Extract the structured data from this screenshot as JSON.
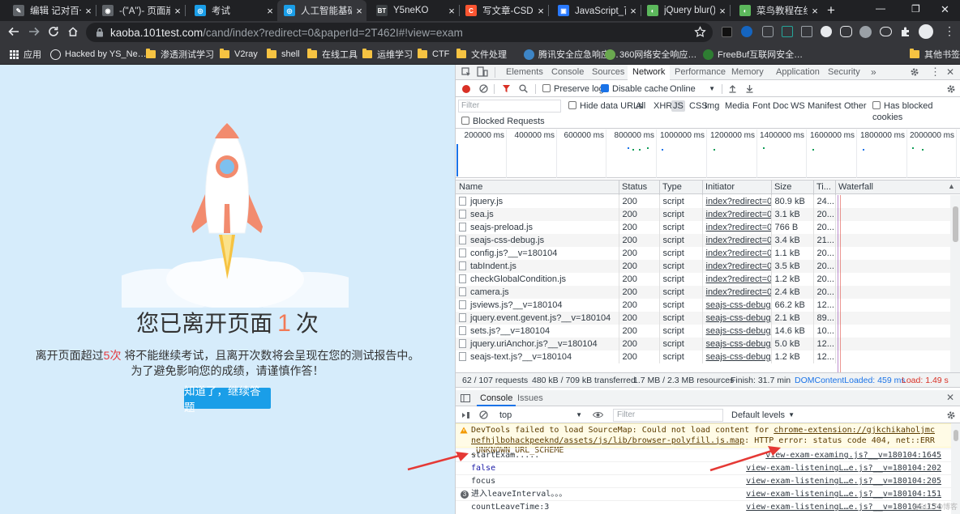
{
  "browser": {
    "tabs": [
      {
        "title": "编辑 记对百一…",
        "fav_color": "#5f6368",
        "fav_text": "✎"
      },
      {
        "title": "-(\"A\")- 页面崩…",
        "fav_color": "#5f6368",
        "fav_text": "◉"
      },
      {
        "title": "考试",
        "fav_color": "#1a9ee8",
        "fav_text": "◎"
      },
      {
        "title": "人工智能基础-",
        "fav_color": "#1a9ee8",
        "fav_text": "◎",
        "active": true
      },
      {
        "title": "Y5neKO",
        "fav_color": "#3c4043",
        "fav_text": "BT"
      },
      {
        "title": "写文章-CSDN…",
        "fav_color": "#fc5531",
        "fav_text": "C"
      },
      {
        "title": "JavaScript_百…",
        "fav_color": "#2979ff",
        "fav_text": "▣"
      },
      {
        "title": "jQuery blur() …",
        "fav_color": "#5cb85c",
        "fav_text": "◐"
      },
      {
        "title": "菜鸟教程在线…",
        "fav_color": "#5cb85c",
        "fav_text": "◐"
      }
    ],
    "new_tab": "+",
    "window_controls": {
      "minimize": "—",
      "restore": "❐",
      "close": "✕"
    },
    "address": {
      "host": "kaoba.101test.com",
      "path": "/cand/index?redirect=0&paperId=2T462I#!view=exam"
    },
    "bookmarks": [
      {
        "label": "应用",
        "kind": "apps"
      },
      {
        "label": "Hacked by YS_Ne…",
        "kind": "globe"
      },
      {
        "label": "渗透测试学习",
        "kind": "folder"
      },
      {
        "label": "V2ray",
        "kind": "folder"
      },
      {
        "label": "shell",
        "kind": "folder"
      },
      {
        "label": "在线工具",
        "kind": "folder"
      },
      {
        "label": "运维学习",
        "kind": "folder"
      },
      {
        "label": "CTF",
        "kind": "folder"
      },
      {
        "label": "文件处理",
        "kind": "folder"
      },
      {
        "label": "腾讯安全应急响应…",
        "kind": "site"
      },
      {
        "label": "360网络安全响应…",
        "kind": "site"
      },
      {
        "label": "FreeBuf互联网安全…",
        "kind": "site"
      },
      {
        "label": "其他书签",
        "kind": "folder"
      }
    ]
  },
  "page": {
    "headline_prefix": "您已离开页面",
    "leave_count": "1",
    "headline_suffix": "次",
    "warning_prefix": "离开页面超过",
    "warning_limit": "5次",
    "warning_suffix": " 将不能继续考试，且离开次数将会呈现在您的测试报告中。",
    "advice": "为了避免影响您的成绩，请谨慎作答！",
    "confirm_button": "知道了，继续答题"
  },
  "devtools": {
    "tabs": [
      "Elements",
      "Console",
      "Sources",
      "Network",
      "Performance",
      "Memory",
      "Application",
      "Security"
    ],
    "active_tab": "Network",
    "more_tabs": "»",
    "toolbar": {
      "preserve_log": "Preserve log",
      "disable_cache": "Disable cache",
      "throttle": "Online"
    },
    "filter": {
      "placeholder": "Filter",
      "hide_data_urls": "Hide data URLs",
      "types": [
        "All",
        "XHR",
        "JS",
        "CSS",
        "Img",
        "Media",
        "Font",
        "Doc",
        "WS",
        "Manifest",
        "Other"
      ],
      "selected_type": "JS",
      "has_blocked_cookies": "Has blocked cookies",
      "blocked_requests": "Blocked Requests"
    },
    "timeline_ticks": [
      "200000 ms",
      "400000 ms",
      "600000 ms",
      "800000 ms",
      "1000000 ms",
      "1200000 ms",
      "1400000 ms",
      "1600000 ms",
      "1800000 ms",
      "2000000 ms"
    ],
    "columns": [
      "Name",
      "Status",
      "Type",
      "Initiator",
      "Size",
      "Ti...",
      "Waterfall"
    ],
    "rows": [
      {
        "name": "jquery.js",
        "status": "200",
        "type": "script",
        "initiator": "index?redirect=0...",
        "size": "80.9 kB",
        "time": "24..."
      },
      {
        "name": "sea.js",
        "status": "200",
        "type": "script",
        "initiator": "index?redirect=0...",
        "size": "3.1 kB",
        "time": "20..."
      },
      {
        "name": "seajs-preload.js",
        "status": "200",
        "type": "script",
        "initiator": "index?redirect=0...",
        "size": "766 B",
        "time": "20..."
      },
      {
        "name": "seajs-css-debug.js",
        "status": "200",
        "type": "script",
        "initiator": "index?redirect=0...",
        "size": "3.4 kB",
        "time": "21..."
      },
      {
        "name": "config.js?__v=180104",
        "status": "200",
        "type": "script",
        "initiator": "index?redirect=0...",
        "size": "1.1 kB",
        "time": "20..."
      },
      {
        "name": "tabIndent.js",
        "status": "200",
        "type": "script",
        "initiator": "index?redirect=0...",
        "size": "3.5 kB",
        "time": "20..."
      },
      {
        "name": "checkGlobalCondition.js",
        "status": "200",
        "type": "script",
        "initiator": "index?redirect=0...",
        "size": "1.2 kB",
        "time": "20..."
      },
      {
        "name": "camera.js",
        "status": "200",
        "type": "script",
        "initiator": "index?redirect=0...",
        "size": "2.4 kB",
        "time": "20..."
      },
      {
        "name": "jsviews.js?__v=180104",
        "status": "200",
        "type": "script",
        "initiator": "seajs-css-debug.j...",
        "size": "66.2 kB",
        "time": "12..."
      },
      {
        "name": "jquery.event.gevent.js?__v=180104",
        "status": "200",
        "type": "script",
        "initiator": "seajs-css-debug.j...",
        "size": "2.1 kB",
        "time": "89..."
      },
      {
        "name": "sets.js?__v=180104",
        "status": "200",
        "type": "script",
        "initiator": "seajs-css-debug.j...",
        "size": "14.6 kB",
        "time": "10..."
      },
      {
        "name": "jquery.uriAnchor.js?__v=180104",
        "status": "200",
        "type": "script",
        "initiator": "seajs-css-debug.j...",
        "size": "5.0 kB",
        "time": "12..."
      },
      {
        "name": "seajs-text.js?__v=180104",
        "status": "200",
        "type": "script",
        "initiator": "seajs-css-debug.j...",
        "size": "1.2 kB",
        "time": "12..."
      }
    ],
    "summary": {
      "requests": "62 / 107 requests",
      "transferred": "480 kB / 709 kB transferred",
      "resources": "1.7 MB / 2.3 MB resources",
      "finish": "Finish: 31.7 min",
      "dcl": "DOMContentLoaded: 459 ms",
      "load": "Load: 1.49 s"
    },
    "drawer": {
      "tabs": [
        "Console",
        "Issues"
      ],
      "active_tab": "Console",
      "context": "top",
      "filter_placeholder": "Filter",
      "levels": "Default levels"
    },
    "console": [
      {
        "kind": "warning",
        "text": "DevTools failed to load SourceMap: Could not load content for ",
        "link": "chrome-extension://gjkchikaholjmcnefhjlbohackpeeknd/assets/js/lib/browser-polyfill.js.map",
        "rest": ": HTTP error: status code 404, net::ERR_UNKNOWN_URL_SCHEME"
      },
      {
        "kind": "log",
        "text": "startExam.....",
        "source": "view-exam-examing.js?__v=180104:1645"
      },
      {
        "kind": "log-blue",
        "text": "false",
        "source": "view-exam-listeningL…e.js?__v=180104:202"
      },
      {
        "kind": "log",
        "text": "focus",
        "source": "view-exam-listeningL…e.js?__v=180104:205"
      },
      {
        "kind": "group",
        "badge": "3",
        "text": "进入leaveInterval。。。",
        "source": "view-exam-listeningL…e.js?__v=180104:151"
      },
      {
        "kind": "log",
        "text": "countLeaveTime:3",
        "source": "view-exam-listeningL…e.js?__v=180104:154"
      }
    ],
    "watermark": "@51CTO博客"
  }
}
